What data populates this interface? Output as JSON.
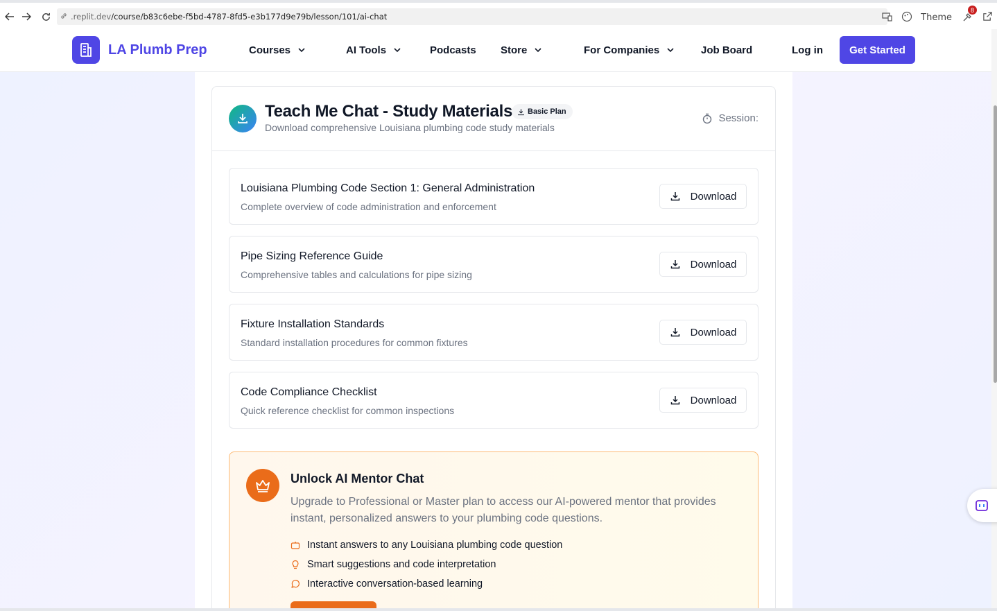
{
  "browser": {
    "url_prefix": ".replit.dev",
    "url_path": "/course/b83c6ebe-f5bd-4787-8fd5-e3b177d9e79b/lesson/101/ai-chat",
    "theme_label": "Theme",
    "extensions_badge": "8"
  },
  "header": {
    "brand": "LA Plumb Prep",
    "nav": {
      "courses": "Courses",
      "ai_tools": "AI Tools",
      "podcasts": "Podcasts",
      "store": "Store",
      "for_companies": "For Companies",
      "job_board": "Job Board",
      "login": "Log in",
      "get_started": "Get Started"
    }
  },
  "card": {
    "title": "Teach Me Chat - Study Materials",
    "plan_badge": "Basic Plan",
    "subtitle": "Download comprehensive Louisiana plumbing code study materials",
    "session_label": "Session:",
    "materials": [
      {
        "title": "Louisiana Plumbing Code Section 1: General Administration",
        "description": "Complete overview of code administration and enforcement",
        "button": "Download"
      },
      {
        "title": "Pipe Sizing Reference Guide",
        "description": "Comprehensive tables and calculations for pipe sizing",
        "button": "Download"
      },
      {
        "title": "Fixture Installation Standards",
        "description": "Standard installation procedures for common fixtures",
        "button": "Download"
      },
      {
        "title": "Code Compliance Checklist",
        "description": "Quick reference checklist for common inspections",
        "button": "Download"
      }
    ]
  },
  "upsell": {
    "title": "Unlock AI Mentor Chat",
    "description": "Upgrade to Professional or Master plan to access our AI-powered mentor that provides instant, personalized answers to your plumbing code questions.",
    "features": [
      {
        "icon": "bot-icon",
        "text": "Instant answers to any Louisiana plumbing code question"
      },
      {
        "icon": "lightbulb-icon",
        "text": "Smart suggestions and code interpretation"
      },
      {
        "icon": "message-circle-icon",
        "text": "Interactive conversation-based learning"
      }
    ]
  },
  "colors": {
    "brand": "#4f46e5",
    "accent_orange": "#ea6c1a",
    "green_gradient_start": "#10b981"
  }
}
